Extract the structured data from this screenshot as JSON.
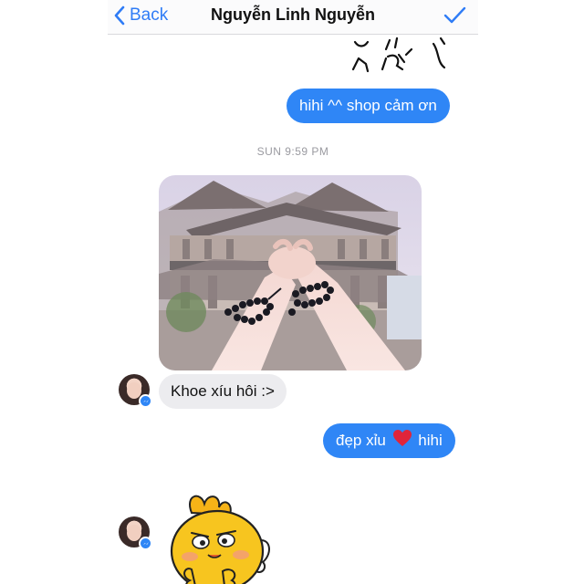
{
  "navbar": {
    "back_label": "Back",
    "title": "Nguyễn Linh Nguyễn"
  },
  "messages": {
    "outgoing_1": "hihi ^^ shop cảm ơn",
    "timestamp": "SUN 9:59 PM",
    "incoming_1": "Khoe xíu hôi :>",
    "outgoing_2_before": "đẹp xỉu",
    "outgoing_2_after": "hihi"
  },
  "colors": {
    "accent": "#2f86f6",
    "incoming_bubble": "#ececef",
    "heart": "#e0243a"
  },
  "icons": {
    "back": "chevron-left-icon",
    "done": "checkmark-icon",
    "messenger_badge": "messenger-icon",
    "heart": "red-heart-emoji",
    "sticker": "yellow-chick-sticker"
  }
}
